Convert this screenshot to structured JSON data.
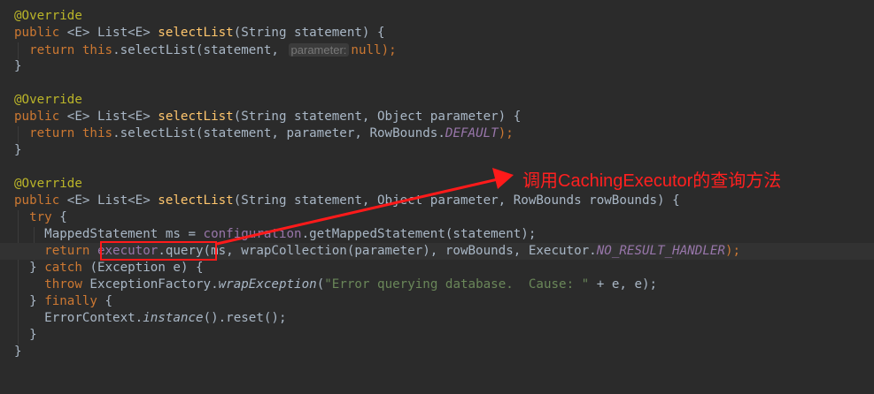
{
  "callout": {
    "text": "调用CachingExecutor的查询方法",
    "color": "#ff2020"
  },
  "colors": {
    "background": "#2b2b2b",
    "keyword": "#cc7832",
    "annotation": "#bbb529",
    "method": "#ffc66d",
    "field": "#9876aa",
    "string": "#6a8759",
    "text": "#a9b7c6",
    "highlight_box": "#ff1a1a"
  },
  "code": {
    "l1": {
      "ann": "@Override"
    },
    "l2": {
      "kw": "public",
      "gen": " <E> List<E> ",
      "fn": "selectList",
      "rest": "(String statement) {"
    },
    "l3": {
      "kw": "return",
      "this": "this",
      "a": ".selectList(statement, ",
      "hint": "parameter:",
      "kw2": "null",
      "b": ");"
    },
    "l4": {
      "t": "}"
    },
    "l6": {
      "ann": "@Override"
    },
    "l7": {
      "kw": "public",
      "gen": " <E> List<E> ",
      "fn": "selectList",
      "rest": "(String statement, Object parameter) {"
    },
    "l8": {
      "kw": "return",
      "this": "this",
      "a": ".selectList(statement, parameter, RowBounds.",
      "field": "DEFAULT",
      "b": ");"
    },
    "l9": {
      "t": "}"
    },
    "l11": {
      "ann": "@Override"
    },
    "l12": {
      "kw": "public",
      "gen": " <E> List<E> ",
      "fn": "selectList",
      "rest": "(String statement, Object parameter, RowBounds rowBounds) {"
    },
    "l13": {
      "kw": "try",
      "rest": " {"
    },
    "l14": {
      "a": "MappedStatement ms = ",
      "field": "configuration",
      "b": ".getMappedStatement(statement);"
    },
    "l15": {
      "kw": "return",
      "field": "executor",
      "a": ".query(ms, wrapCollection(parameter), rowBounds, Executor.",
      "field2": "NO_RESULT_HANDLER",
      "b": ");"
    },
    "l16": {
      "a": "} ",
      "kw": "catch",
      "b": " (Exception e) {"
    },
    "l17": {
      "kw": "throw",
      "a": " ExceptionFactory.",
      "fn": "wrapException",
      "b": "(",
      "str": "\"Error querying database.  Cause: \"",
      "c": " + e, e);"
    },
    "l18": {
      "a": "} ",
      "kw": "finally",
      "b": " {"
    },
    "l19": {
      "a": "ErrorContext.",
      "fn": "instance",
      "b": "().reset();"
    },
    "l20": {
      "t": "}"
    },
    "l21": {
      "t": "}"
    }
  }
}
